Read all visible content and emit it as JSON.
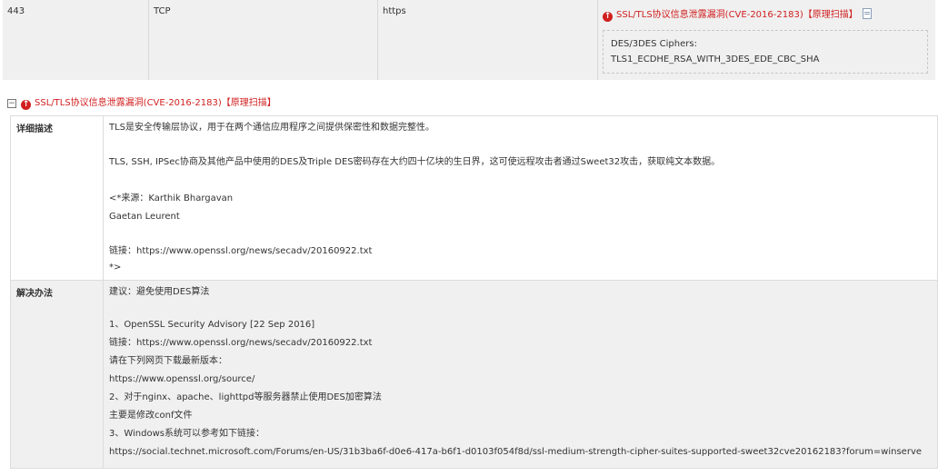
{
  "port_row": {
    "port": "443",
    "protocol": "TCP",
    "service": "https",
    "vuln_link": "SSL/TLS协议信息泄露漏洞(CVE-2016-2183)【原理扫描】",
    "cipher_title": "DES/3DES Ciphers:",
    "cipher_value": "TLS1_ECDHE_RSA_WITH_3DES_EDE_CBC_SHA"
  },
  "section": {
    "toggle": "−",
    "title": "SSL/TLS协议信息泄露漏洞(CVE-2016-2183)【原理扫描】"
  },
  "detail": {
    "description_label": "详细描述",
    "description_lines": [
      "TLS是安全传输层协议，用于在两个通信应用程序之间提供保密性和数据完整性。",
      "",
      "TLS, SSH, IPSec协商及其他产品中使用的DES及Triple DES密码存在大约四十亿块的生日界，这可使远程攻击者通过Sweet32攻击，获取纯文本数据。",
      "",
      "<*来源：Karthik Bhargavan",
      "Gaetan Leurent",
      "",
      "链接：https://www.openssl.org/news/secadv/20160922.txt",
      "*>"
    ],
    "solution_label": "解决办法",
    "solution_lines": [
      "建议：避免使用DES算法",
      "",
      "1、OpenSSL Security Advisory [22 Sep 2016]",
      "链接：https://www.openssl.org/news/secadv/20160922.txt",
      "请在下列网页下载最新版本：",
      "https://www.openssl.org/source/",
      "2、对于nginx、apache、lighttpd等服务器禁止使用DES加密算法",
      "主要是修改conf文件",
      "3、Windows系统可以参考如下链接：",
      "https://social.technet.microsoft.com/Forums/en-US/31b3ba6f-d0e6-417a-b6f1-d0103f054f8d/ssl-medium-strength-cipher-suites-supported-sweet32cve20162183?forum=winserve"
    ]
  }
}
